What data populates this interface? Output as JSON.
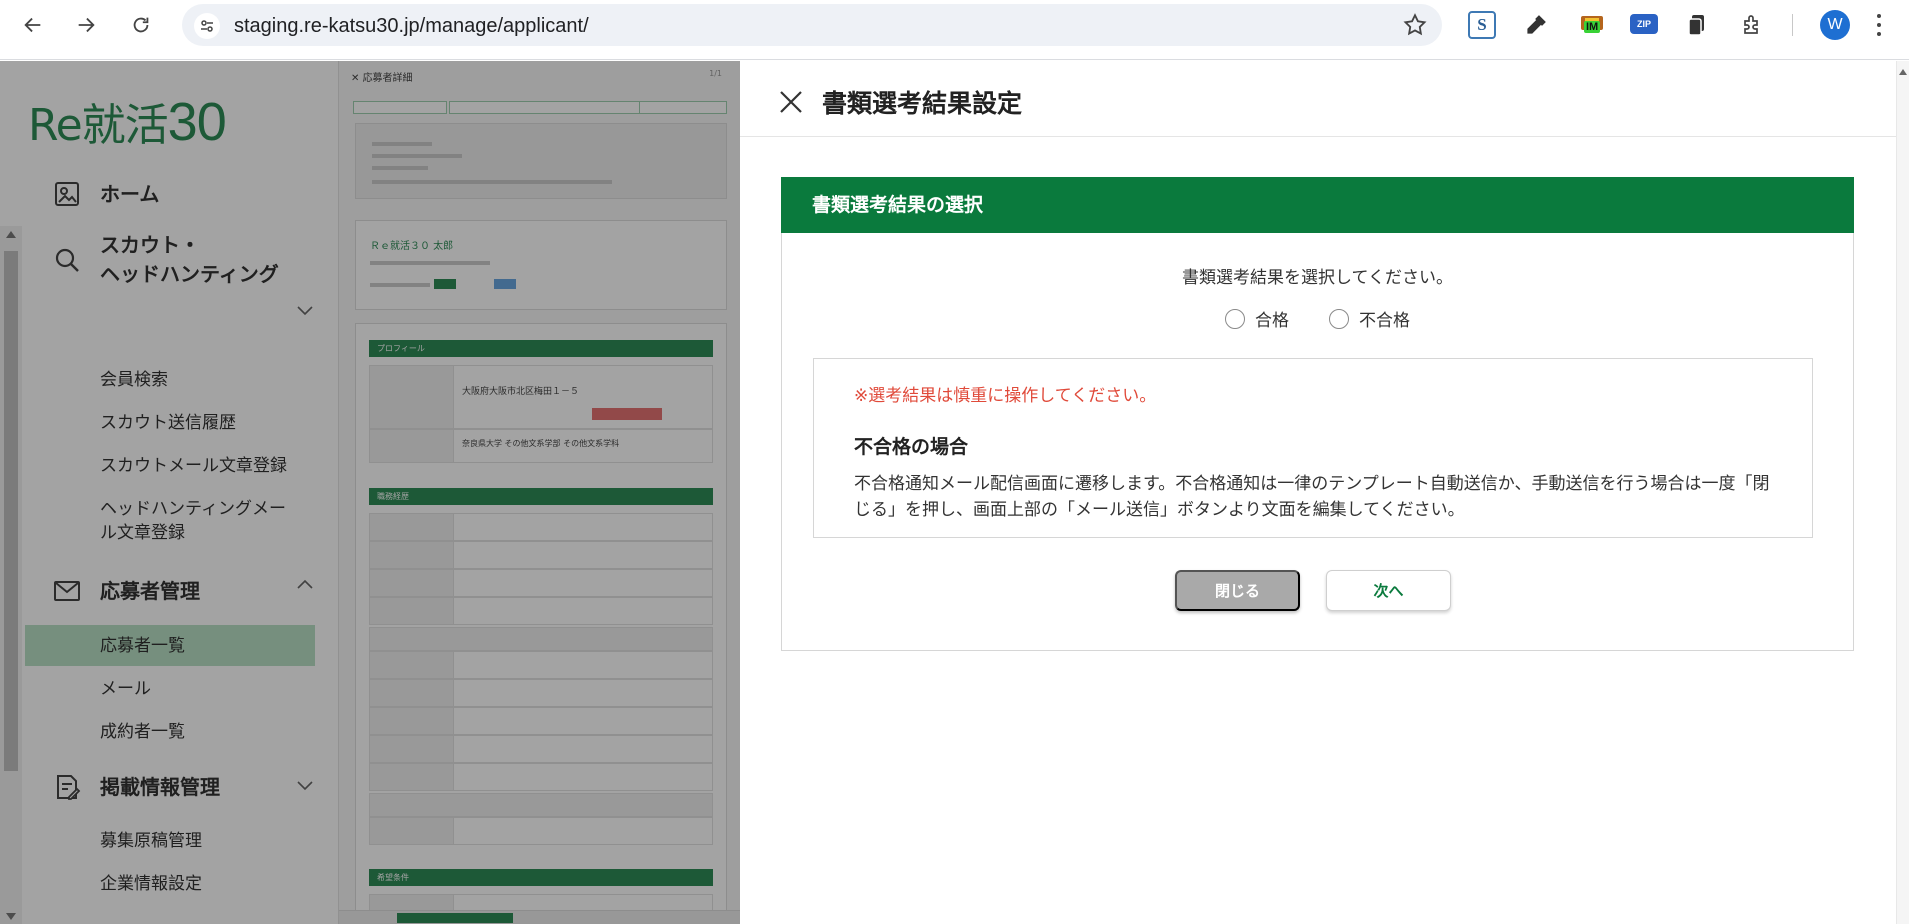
{
  "browser": {
    "url": "staging.re-katsu30.jp/manage/applicant/",
    "profile_initial": "W",
    "extensions": {
      "s_label": "S",
      "im_label": "IM",
      "zip_label": "ZIP"
    }
  },
  "sidebar": {
    "logo_text": "Re就活",
    "logo_number": "30",
    "sections": [
      {
        "label": "ホーム",
        "icon": "home-image-icon"
      },
      {
        "label": "スカウト・\nヘッドハンティング",
        "icon": "search-icon",
        "expand": "chevron-down-icon"
      },
      {
        "label": "応募者管理",
        "icon": "mail-icon",
        "expand": "chevron-up-icon"
      },
      {
        "label": "掲載情報管理",
        "icon": "edit-document-icon",
        "expand": "chevron-down-icon"
      }
    ],
    "scout_items": [
      "会員検索",
      "スカウト送信履歴",
      "スカウトメール文章登録",
      "ヘッドハンティングメー\nル文章登録"
    ],
    "applicant_items": [
      "応募者一覧",
      "メール",
      "成約者一覧"
    ],
    "active_item": "応募者一覧",
    "listing_items": [
      "募集原稿管理",
      "企業情報設定"
    ]
  },
  "background_detail": {
    "title": "応募者詳細",
    "profile_section": "プロフィール",
    "career_section": "職務経歴",
    "preference_section": "希望条件",
    "applicant_name": "Ｒｅ就活３０ 太郎",
    "address": "大阪府大阪市北区梅田１－５",
    "school": "奈良県大学 その他文系学部 その他文系学科"
  },
  "modal": {
    "title": "書類選考結果設定",
    "panel_heading": "書類選考結果の選択",
    "prompt": "書類選考結果を選択してください。",
    "options": [
      "合格",
      "不合格"
    ],
    "warning": "※選考結果は慎重に操作してください。",
    "case_title": "不合格の場合",
    "case_description": "不合格通知メール配信画面に遷移します。不合格通知は一律のテンプレート自動送信か、手動送信を行う場合は一度「閉じる」を押し、画面上部の「メール送信」ボタンより文面を編集してください。",
    "close_button": "閉じる",
    "next_button": "次へ"
  },
  "colors": {
    "brand_green": "#0a7a3d",
    "warning_red": "#e04a3a",
    "disabled_gray": "#a9a9a9"
  }
}
